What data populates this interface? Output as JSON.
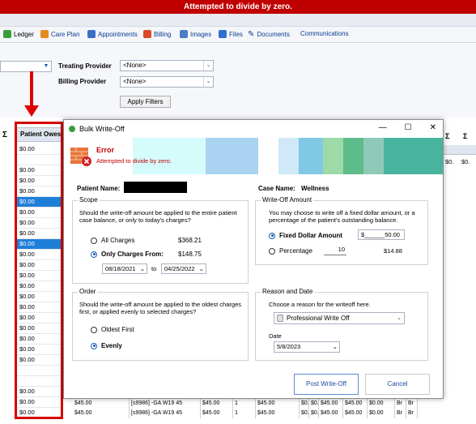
{
  "banner": {
    "error": "Attempted to divide by zero."
  },
  "tabs": [
    {
      "label": "Ledger",
      "icon": "ledger-icon",
      "color": "#3a9d3a"
    },
    {
      "label": "Care Plan",
      "icon": "care-plan-icon",
      "color": "#e58a1f"
    },
    {
      "label": "Appointments",
      "icon": "appointments-icon",
      "color": "#3a6fc4"
    },
    {
      "label": "Billing",
      "icon": "billing-icon",
      "color": "#d94b2b"
    },
    {
      "label": "Images",
      "icon": "images-icon",
      "color": "#4a7fc0"
    },
    {
      "label": "Files",
      "icon": "files-icon",
      "color": "#2e6fd0"
    },
    {
      "label": "Documents",
      "icon": "documents-icon",
      "color": "#444444"
    },
    {
      "label": "Communications",
      "icon": "",
      "color": ""
    }
  ],
  "filters": {
    "treating_label": "Treating Provider",
    "treating_value": "<None>",
    "billing_label": "Billing Provider",
    "billing_value": "<None>",
    "apply_label": "Apply Filters"
  },
  "grid": {
    "sigma": "Σ",
    "sigma_right_1": "Σ",
    "sigma_right_2": "Σ",
    "column_header": "Patient Owes",
    "row_value": "$0.00",
    "right_cell_1": "$0.",
    "right_cell_2": "$0.",
    "bottom_rows": [
      [
        "$45.00",
        "[s9986] -GA W19 45",
        "$45.00",
        "1",
        "$45.00",
        "$0.",
        "$0.",
        "$45.00",
        "$45.00",
        "$0.00",
        "Br",
        "Br"
      ],
      [
        "$45.00",
        "[s9986] -GA W19 45",
        "$45.00",
        "1",
        "$45.00",
        "$0.",
        "$0.",
        "$45.00",
        "$45.00",
        "$0.00",
        "Br",
        "Br"
      ]
    ]
  },
  "dialog": {
    "title": "Bulk Write-Off",
    "window_minimize": "—",
    "window_maximize": "☐",
    "window_close": "✕",
    "error_title": "Error",
    "error_message": "Attempted to divide by zero.",
    "patient_name_label": "Patient Name:",
    "case_name_label": "Case Name:",
    "case_name_value": "Wellness",
    "scope": {
      "title": "Scope",
      "question": "Should the write-off amount be applied to the entire patient case balance, or only to today's charges?",
      "all_label": "All Charges",
      "all_amount": "$368.21",
      "only_label": "Only Charges From:",
      "only_amount": "$148.75",
      "from_date": "08/18/2021",
      "to_label": "to",
      "to_date": "04/25/2022"
    },
    "writeoff": {
      "title": "Write-Off Amount",
      "question": "You may choose to write off a fixed dollar amount, or a percentage of the patient's outstanding balance.",
      "fixed_label": "Fixed Dollar Amount",
      "fixed_value": "$______50.00",
      "pct_label": "Percentage",
      "pct_value": "10",
      "pct_amount": "$14.88"
    },
    "order": {
      "title": "Order",
      "question": "Should the write-off amount be applied to the oldest charges first, or applied evenly to selected charges?",
      "oldest_label": "Oldest First",
      "evenly_label": "Evenly"
    },
    "reason": {
      "title": "Reason and Date",
      "prompt": "Choose a reason for the writeoff here.",
      "reason_value": "Professional Write Off",
      "date_label": "Date",
      "date_value": "5/8/2023"
    },
    "post_label": "Post Write-Off",
    "cancel_label": "Cancel"
  },
  "colors": {
    "error_red": "#c00000",
    "selection_blue": "#1e7fd8",
    "annotation_red": "#d40000"
  }
}
